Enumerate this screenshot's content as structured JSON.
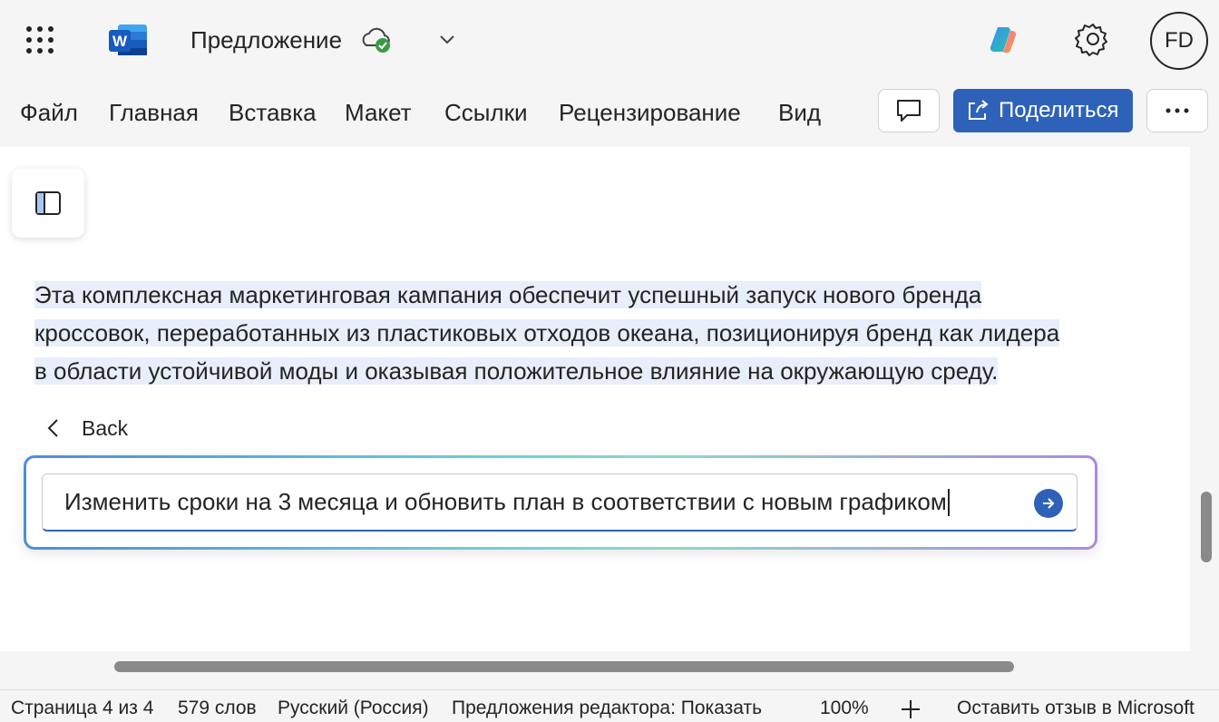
{
  "app": {
    "title": "Предложение",
    "user_initials": "FD"
  },
  "menu": {
    "items": [
      "Файл",
      "Главная",
      "Вставка",
      "Макет",
      "Ссылки",
      "Рецензирование",
      "Вид"
    ],
    "share_label": "Поделиться"
  },
  "document": {
    "paragraph": "Эта комплексная маркетинговая кампания обеспечит успешный запуск нового бренда кроссовок, переработанных из пластиковых отходов океана, позиционируя бренд как лидера в области устойчивой моды и оказывая положительное влияние на окружающую среду.",
    "paragraph_lines": [
      "Эта комплексная маркетинговая кампания обеспечит успешный запуск нового бренда",
      "кроссовок, переработанных из пластиковых отходов океана, позиционируя бренд как лидера",
      "в области устойчивой моды и оказывая положительное влияние на окружающую среду."
    ]
  },
  "copilot": {
    "back_label": "Back",
    "prompt_value": "Изменить сроки на 3 месяца и обновить план в соответствии с новым графиком"
  },
  "statusbar": {
    "page": "Страница 4 из 4",
    "words": "579 слов",
    "language": "Русский (Россия)",
    "editor": "Предложения редактора: Показать",
    "zoom": "100%",
    "feedback": "Оставить отзыв в Microsoft"
  },
  "colors": {
    "accent": "#2e62b8",
    "highlight": "#e8eefa",
    "word_blue": "#185abd"
  },
  "icons": {
    "app_launcher": "waffle-icon",
    "app": "word-icon",
    "save_status": "cloud-check-icon",
    "copilot": "copilot-icon",
    "settings": "gear-icon",
    "comment": "comment-icon",
    "share": "share-icon",
    "more": "more-icon",
    "nav_pane": "panel-icon",
    "back": "chevron-left-icon",
    "send": "arrow-right-icon",
    "zoom_in": "plus-icon"
  }
}
